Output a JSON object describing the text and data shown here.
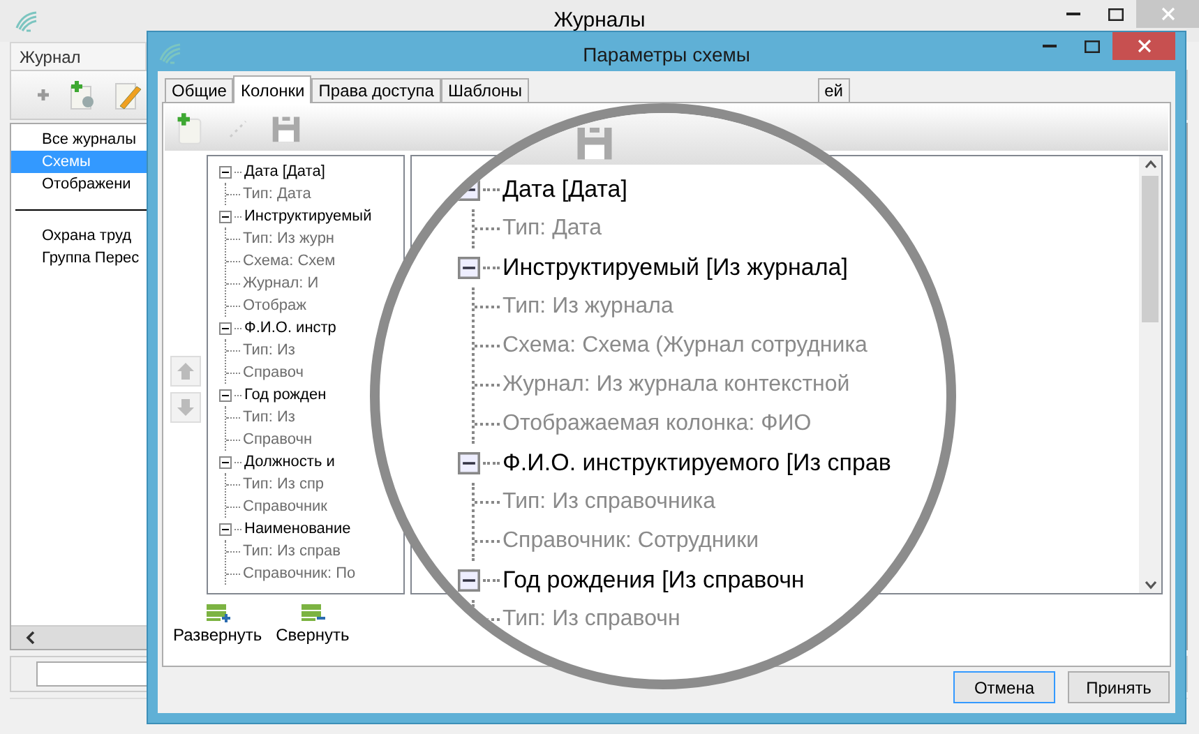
{
  "main_window": {
    "title": "Журналы",
    "menu_tab": "Журнал",
    "items": [
      {
        "label": "Все журналы",
        "selected": false
      },
      {
        "label": "Схемы",
        "selected": true
      },
      {
        "label": "Отображени",
        "selected": false
      }
    ],
    "group_items": [
      {
        "label": "Охрана труд",
        "selected": false
      },
      {
        "label": "Группа Перес",
        "selected": false
      }
    ]
  },
  "dialog": {
    "title": "Параметры схемы",
    "tabs": [
      {
        "label": "Общие",
        "selected": false
      },
      {
        "label": "Колонки",
        "selected": true
      },
      {
        "label": "Права доступа",
        "selected": false
      },
      {
        "label": "Шаблоны",
        "selected": false
      },
      {
        "label": "ей",
        "selected": false
      }
    ],
    "column_tree": [
      {
        "label": "Дата [Дата]",
        "expanded": true,
        "children": [
          {
            "label": "Тип: Дата"
          }
        ]
      },
      {
        "label": "Инструктируемый",
        "expanded": true,
        "children": [
          {
            "label": "Тип: Из журн"
          },
          {
            "label": "Схема: Схем"
          },
          {
            "label": "Журнал: И"
          },
          {
            "label": "Отображ"
          }
        ]
      },
      {
        "label": "Ф.И.О. инстр",
        "expanded": true,
        "children": [
          {
            "label": "Тип: Из"
          },
          {
            "label": "Справоч"
          }
        ]
      },
      {
        "label": "Год рожден",
        "expanded": true,
        "children": [
          {
            "label": "Тип: Из"
          },
          {
            "label": "Справочн"
          }
        ]
      },
      {
        "label": "Должность и",
        "expanded": true,
        "children": [
          {
            "label": "Тип: Из спр"
          },
          {
            "label": "Справочник"
          }
        ]
      },
      {
        "label": "Наименование",
        "expanded": true,
        "children": [
          {
            "label": "Тип: Из справ"
          },
          {
            "label": "Справочник: По"
          }
        ]
      }
    ],
    "tree_buttons": [
      {
        "label": "Развернуть",
        "kind": "expand"
      },
      {
        "label": "Свернуть",
        "kind": "collapse"
      }
    ],
    "buttons": [
      {
        "label": "Отмена",
        "focused": true
      },
      {
        "label": "Принять",
        "focused": false
      }
    ]
  },
  "magnifier": {
    "tree": [
      {
        "label": "Дата [Дата]",
        "expanded": true,
        "children": [
          {
            "label": "Тип: Дата"
          }
        ]
      },
      {
        "label": "Инструктируемый [Из журнала]",
        "expanded": true,
        "children": [
          {
            "label": "Тип: Из журнала"
          },
          {
            "label": "Схема: Схема (Журнал сотрудника"
          },
          {
            "label": "Журнал: Из журнала контекстной"
          },
          {
            "label": "Отображаемая колонка: ФИО"
          }
        ]
      },
      {
        "label": "Ф.И.О. инструктируемого [Из справ",
        "expanded": true,
        "children": [
          {
            "label": "Тип: Из справочника"
          },
          {
            "label": "Справочник: Сотрудники"
          }
        ]
      },
      {
        "label": "Год рождения [Из справочн",
        "expanded": true,
        "children": [
          {
            "label": "Тип: Из справочн"
          }
        ]
      }
    ]
  }
}
